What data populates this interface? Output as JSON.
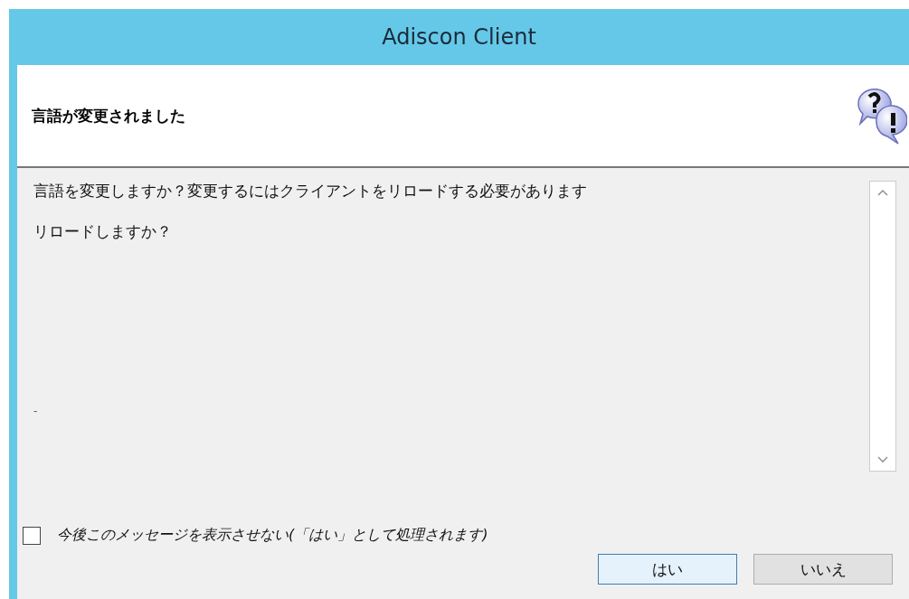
{
  "window": {
    "title": "Adiscon Client"
  },
  "header": {
    "title": "言語が変更されました"
  },
  "message": {
    "lines": [
      "言語を変更しますか？変更するにはクライアントをリロードする必要があります",
      "リロードしますか？"
    ],
    "footer_mark": "-"
  },
  "checkbox": {
    "label": "今後このメッセージを表示させない(「はい」として処理されます)",
    "checked": false
  },
  "buttons": [
    {
      "label": "はい",
      "selected": true
    },
    {
      "label": "いいえ",
      "selected": false
    }
  ]
}
